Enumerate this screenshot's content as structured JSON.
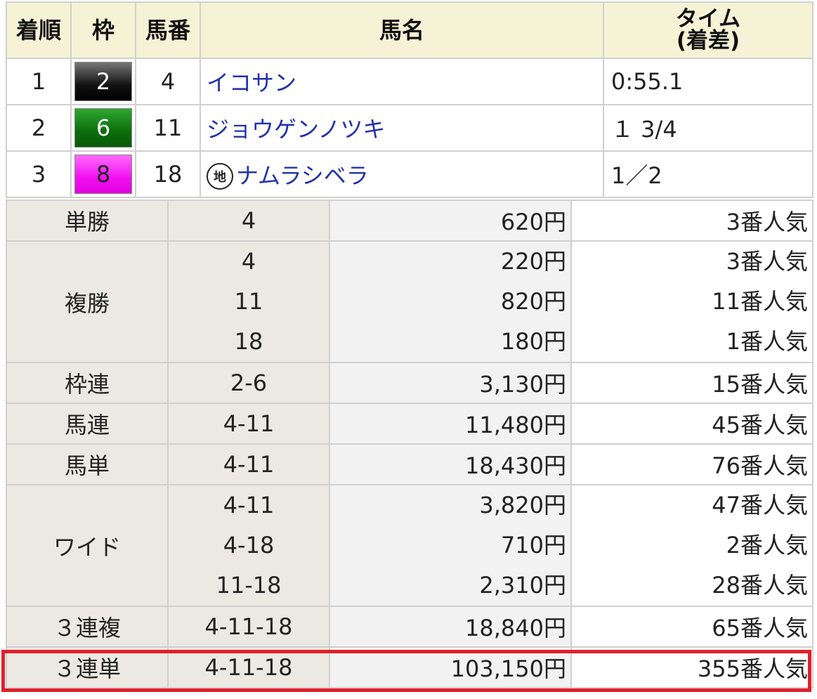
{
  "results": {
    "headers": {
      "rank": "着順",
      "waku": "枠",
      "umaban": "馬番",
      "name": "馬名",
      "time_line1": "タイム",
      "time_line2": "(着差)"
    },
    "rows": [
      {
        "rank": "1",
        "waku": "2",
        "umaban": "4",
        "name": "イコサン",
        "local_badge": "",
        "time": "0:55.1"
      },
      {
        "rank": "2",
        "waku": "6",
        "umaban": "11",
        "name": "ジョウゲンノツキ",
        "local_badge": "",
        "time": "１ 3/4"
      },
      {
        "rank": "3",
        "waku": "8",
        "umaban": "18",
        "name": "ナムラシベラ",
        "local_badge": "地",
        "time": "1／2"
      }
    ]
  },
  "payout": {
    "rows": [
      {
        "bet": "単勝",
        "entries": [
          {
            "combo": "4",
            "pay": "620円",
            "pop": "3番人気"
          }
        ]
      },
      {
        "bet": "複勝",
        "entries": [
          {
            "combo": "4",
            "pay": "220円",
            "pop": "3番人気"
          },
          {
            "combo": "11",
            "pay": "820円",
            "pop": "11番人気"
          },
          {
            "combo": "18",
            "pay": "180円",
            "pop": "1番人気"
          }
        ]
      },
      {
        "bet": "枠連",
        "entries": [
          {
            "combo": "2-6",
            "pay": "3,130円",
            "pop": "15番人気"
          }
        ]
      },
      {
        "bet": "馬連",
        "entries": [
          {
            "combo": "4-11",
            "pay": "11,480円",
            "pop": "45番人気"
          }
        ]
      },
      {
        "bet": "馬単",
        "entries": [
          {
            "combo": "4-11",
            "pay": "18,430円",
            "pop": "76番人気"
          }
        ]
      },
      {
        "bet": "ワイド",
        "entries": [
          {
            "combo": "4-11",
            "pay": "3,820円",
            "pop": "47番人気"
          },
          {
            "combo": "4-18",
            "pay": "710円",
            "pop": "2番人気"
          },
          {
            "combo": "11-18",
            "pay": "2,310円",
            "pop": "28番人気"
          }
        ]
      },
      {
        "bet": "３連複",
        "entries": [
          {
            "combo": "4-11-18",
            "pay": "18,840円",
            "pop": "65番人気"
          }
        ]
      },
      {
        "bet": "３連単",
        "entries": [
          {
            "combo": "4-11-18",
            "pay": "103,150円",
            "pop": "355番人気"
          }
        ]
      }
    ]
  },
  "colors": {
    "header_bg": "#f5f2d5",
    "horse_link": "#2233aa",
    "highlight_border": "#e0202a",
    "waku_2": "#000000",
    "waku_6": "#0b6d0b",
    "waku_8": "#f010f0"
  }
}
